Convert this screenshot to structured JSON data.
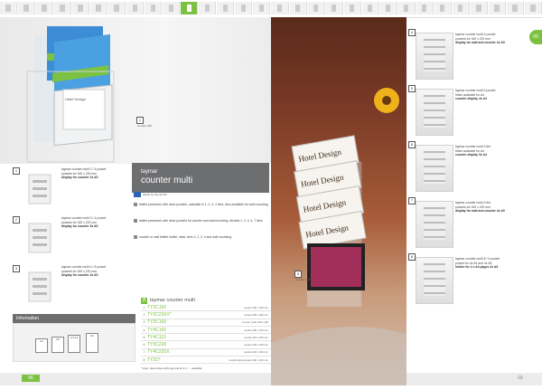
{
  "strip": {
    "count": 30,
    "active_index": 10
  },
  "side_tab": {
    "label": "09"
  },
  "left_page": {
    "hero_badge": "1",
    "hero_caption": "counter 160",
    "variants": [
      {
        "badge": "1",
        "line1": "taymar counter multi 2 / 3 pocket",
        "line2": "pockets for 160 x 220 mm",
        "line3": "display for counter 2x A5"
      },
      {
        "badge": "2",
        "line1": "taymar counter multi 3 / 4 pocket",
        "line2": "pockets for 160 x 220 mm",
        "line3": "display for counter 3x A5"
      },
      {
        "badge": "3",
        "line1": "taymar counter multi 4 / 5 pocket",
        "line2": "pockets for 160 x 220 mm",
        "line3": "display for counter 4x A5"
      }
    ],
    "title_brand": "taymar",
    "title_name": "counter multi",
    "subtitle": "Model by taymar/SV",
    "paragraphs": [
      "leaflet presentoir with clear pockets, available in 1, 2, 3, 4 tiers. Also available for wall mounting.",
      "leaflet presentoir with clear pockets for counter and wall mounting. Models 1, 2, 3, 4, 7 tiers.",
      "counter or wall leaflet holder, clear, tiers 1, 2, 3, 4 and wall mounting."
    ],
    "info_title": "Information",
    "dims": [
      "A4",
      "A5",
      "1/3 A4",
      "A6"
    ],
    "table_title": "taymar counter multi",
    "table_rows": [
      {
        "idx": "1",
        "code": "TY2C160",
        "desc": "pocket 160 x 220 mm"
      },
      {
        "idx": "2",
        "code": "TY2C230X*",
        "desc": "pocket 230 x 320 mm"
      },
      {
        "idx": "3",
        "code": "TY3C160",
        "desc": "counter multi 160 x 220"
      },
      {
        "idx": "4",
        "code": "TY4C160",
        "desc": "pocket 160 x 220 mm"
      },
      {
        "idx": "5",
        "code": "TY4C110",
        "desc": "pocket 110 x 220 mm"
      },
      {
        "idx": "6",
        "code": "TY3C230",
        "desc": "pocket 230 x 320 mm"
      },
      {
        "idx": "7",
        "code": "TY4C230X",
        "desc": "pocket 230 x 320 mm"
      },
      {
        "idx": "8",
        "code": "TY2D*",
        "desc": "double sided pocket 160 x 220 mm"
      }
    ],
    "footnote": "* Hipo: assembled with bag and kit in 1 ... available",
    "page_number": "06"
  },
  "center": {
    "cards": [
      "Hotel Design",
      "Hotel Design",
      "Hotel Design",
      "Hotel Design"
    ],
    "badge": "5",
    "caption": "counter multi"
  },
  "right_page": {
    "items": [
      {
        "badge": "4",
        "line1": "taymar counter multi 4 pocket",
        "line2": "pockets for 160 x 220 mm",
        "line3": "display for wall and counter 4x A5"
      },
      {
        "badge": "5",
        "line1": "taymar counter multi 5 pocket",
        "line2": "finish available for A4",
        "line3": "counter display 4x A4"
      },
      {
        "badge": "6",
        "line1": "taymar counter multi 3 tier",
        "line2": "finish available for A4",
        "line3": "counter display 3x A4"
      },
      {
        "badge": "7",
        "line1": "taymar counter multi 4 tier",
        "line2": "pockets for 160 x 220 mm",
        "line3": "display for wall and counter 4x A5"
      },
      {
        "badge": "8",
        "line1": "taymar counter multi 8 / 4 pocket",
        "line2": "pocket for 4x A4 and 4x A5",
        "line3": "holder for 4 x A4 pages 4x A5"
      }
    ],
    "page_number": "09"
  },
  "colors": {
    "accent": "#7cc242",
    "title_bg": "#6d6e70"
  }
}
